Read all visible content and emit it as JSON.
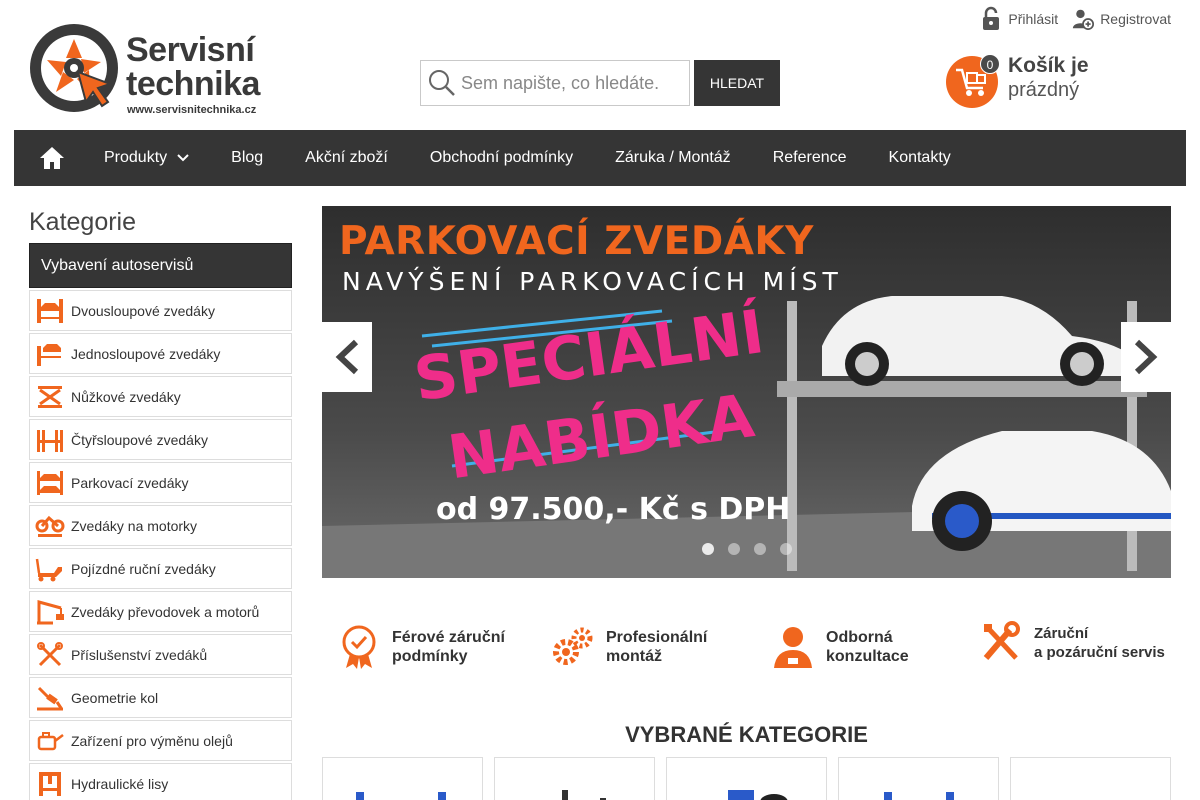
{
  "logo": {
    "line1": "Servisní",
    "line2": "technika",
    "url": "www.servisnitechnika.cz"
  },
  "toplinks": {
    "login": "Přihlásit",
    "register": "Registrovat"
  },
  "search": {
    "placeholder": "Sem napište, co hledáte.",
    "button": "HLEDAT"
  },
  "cart": {
    "count": "0",
    "line1": "Košík je",
    "line2": "prázdný"
  },
  "nav": {
    "items": [
      "Produkty",
      "Blog",
      "Akční zboží",
      "Obchodní podmínky",
      "Záruka / Montáž",
      "Reference",
      "Kontakty"
    ]
  },
  "sidebar": {
    "title": "Kategorie",
    "head": "Vybavení autoservisů",
    "items": [
      {
        "label": "Dvousloupové zvedáky",
        "icon": "two-post-lift-icon"
      },
      {
        "label": "Jednosloupové zvedáky",
        "icon": "single-post-lift-icon"
      },
      {
        "label": "Nůžkové zvedáky",
        "icon": "scissor-lift-icon"
      },
      {
        "label": "Čtyřsloupové zvedáky",
        "icon": "four-post-lift-icon"
      },
      {
        "label": "Parkovací zvedáky",
        "icon": "parking-lift-icon"
      },
      {
        "label": "Zvedáky na motorky",
        "icon": "motorcycle-lift-icon"
      },
      {
        "label": "Pojízdné ruční zvedáky",
        "icon": "floor-jack-icon"
      },
      {
        "label": "Zvedáky převodovek a motorů",
        "icon": "engine-crane-icon"
      },
      {
        "label": "Příslušenství zvedáků",
        "icon": "tools-icon"
      },
      {
        "label": "Geometrie kol",
        "icon": "wheel-alignment-icon"
      },
      {
        "label": "Zařízení pro výměnu olejů",
        "icon": "oil-can-icon"
      },
      {
        "label": "Hydraulické lisy",
        "icon": "hydraulic-press-icon"
      }
    ]
  },
  "banner": {
    "headline": "PARKOVACÍ ZVEDÁKY",
    "subline": "NAVÝŠENÍ PARKOVACÍCH MÍST",
    "special1": "SPECIÁLNÍ",
    "special2": "NABÍDKA",
    "price": "od 97.500,- Kč s DPH",
    "slides": 4,
    "active_slide": 1
  },
  "features": [
    {
      "line1": "Férové záruční",
      "line2": "podmínky",
      "icon": "badge-check-icon"
    },
    {
      "line1": "Profesionální",
      "line2": "montáž",
      "icon": "gears-icon"
    },
    {
      "line1": "Odborná",
      "line2": "konzultace",
      "icon": "support-agent-icon"
    },
    {
      "line1": "Záruční",
      "line2": "a pozáruční servis",
      "icon": "wrench-screwdriver-icon"
    }
  ],
  "categories": {
    "title": "VYBRANÉ KATEGORIE",
    "count": 5
  },
  "colors": {
    "accent": "#f0661e",
    "dark": "#353535",
    "pink": "#ef2d8a"
  }
}
